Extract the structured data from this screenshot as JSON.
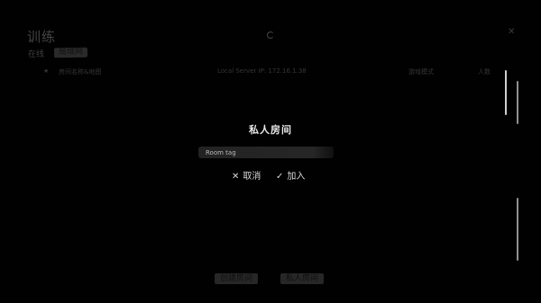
{
  "lobby": {
    "title": "训练",
    "tabs": {
      "online": "在线",
      "lan": "局域网"
    },
    "icons": {
      "refresh": "refresh-icon",
      "close": "close-icon",
      "star": "star-icon"
    },
    "header": {
      "star": "★",
      "room_name_map": "房间名称&地图",
      "server_ip": "Local Server IP: 172.16.1.38",
      "game_mode": "游戏模式",
      "player_count": "人数"
    },
    "bottom_buttons": {
      "create_room": "创建房间",
      "private_room": "私人房间"
    }
  },
  "modal": {
    "title": "私人房间",
    "input": {
      "placeholder": "Room tag",
      "value": ""
    },
    "cancel": {
      "icon": "close-icon",
      "glyph": "✕",
      "label": "取消"
    },
    "join": {
      "icon": "check-icon",
      "glyph": "✓",
      "label": "加入"
    }
  },
  "colors": {
    "background": "#010101",
    "modal_text": "#e8e8e8",
    "dim_text": "#6e6e6e",
    "accent_bar": "#cfcfcf"
  }
}
